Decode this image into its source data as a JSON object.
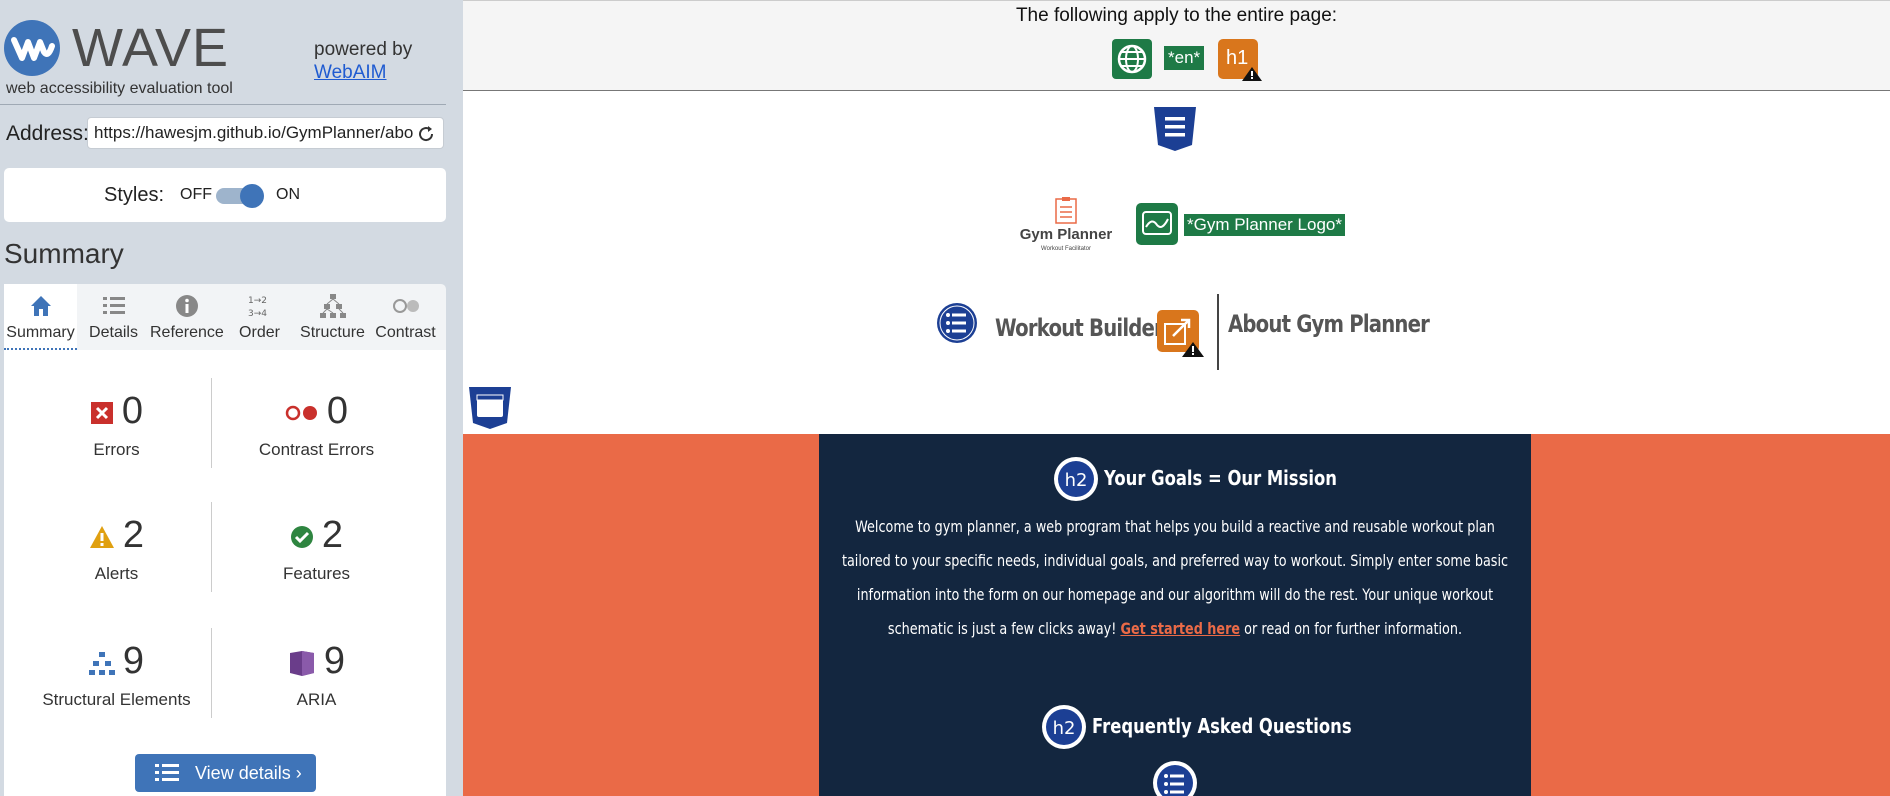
{
  "wave": {
    "wordmark": "WAVE",
    "tagline": "web accessibility evaluation tool",
    "powered_by": "powered by",
    "powered_link": "WebAIM",
    "address_label": "Address:",
    "address_value": "https://hawesjm.github.io/GymPlanner/about",
    "styles_label": "Styles:",
    "styles_off": "OFF",
    "styles_on": "ON",
    "styles_enabled": true,
    "summary_heading": "Summary",
    "tabs": [
      {
        "label": "Summary",
        "icon": "home-icon",
        "active": true
      },
      {
        "label": "Details",
        "icon": "list-icon",
        "active": false
      },
      {
        "label": "Reference",
        "icon": "info-icon",
        "active": false
      },
      {
        "label": "Order",
        "icon": "order-icon",
        "active": false
      },
      {
        "label": "Structure",
        "icon": "structure-icon",
        "active": false
      },
      {
        "label": "Contrast",
        "icon": "contrast-icon",
        "active": false
      }
    ],
    "stats": {
      "errors": {
        "value": "0",
        "label": "Errors",
        "color": "#c9302c"
      },
      "contrast_errors": {
        "value": "0",
        "label": "Contrast Errors",
        "color": "#c9302c"
      },
      "alerts": {
        "value": "2",
        "label": "Alerts",
        "color": "#e0a010"
      },
      "features": {
        "value": "2",
        "label": "Features",
        "color": "#2e8540"
      },
      "structural": {
        "value": "9",
        "label": "Structural Elements",
        "color": "#3f74b8"
      },
      "aria": {
        "value": "9",
        "label": "ARIA",
        "color": "#6a3d8a"
      }
    },
    "view_details": "View details ›"
  },
  "page": {
    "banner_text": "The following apply to the entire page:",
    "lang_label": "*en*",
    "h1_label": "h1",
    "logo_title": "Gym Planner",
    "logo_subtitle": "Workout Facilitator",
    "logo_alt": "*Gym Planner Logo*",
    "nav": {
      "workout_builder": "Workout Builder",
      "about": "About Gym Planner"
    },
    "hero": {
      "heading": "Your Goals = Our Mission",
      "h2_label": "h2",
      "para_before": "Welcome to gym planner, a web program that helps you build a reactive and reusable workout plan tailored to your specific needs, individual goals, and preferred way to workout. Simply enter some basic information into the form on our homepage and our algorithm will do the rest. Your unique workout schematic is just a few clicks away! ",
      "link": "Get started here",
      "para_after": " or read on for further information.",
      "faq_heading": "Frequently Asked Questions"
    },
    "colors": {
      "hero_bg": "#ea6a47",
      "card_bg": "#13263f",
      "feature_green": "#1e7a46",
      "wave_blue": "#3f74b8"
    }
  }
}
